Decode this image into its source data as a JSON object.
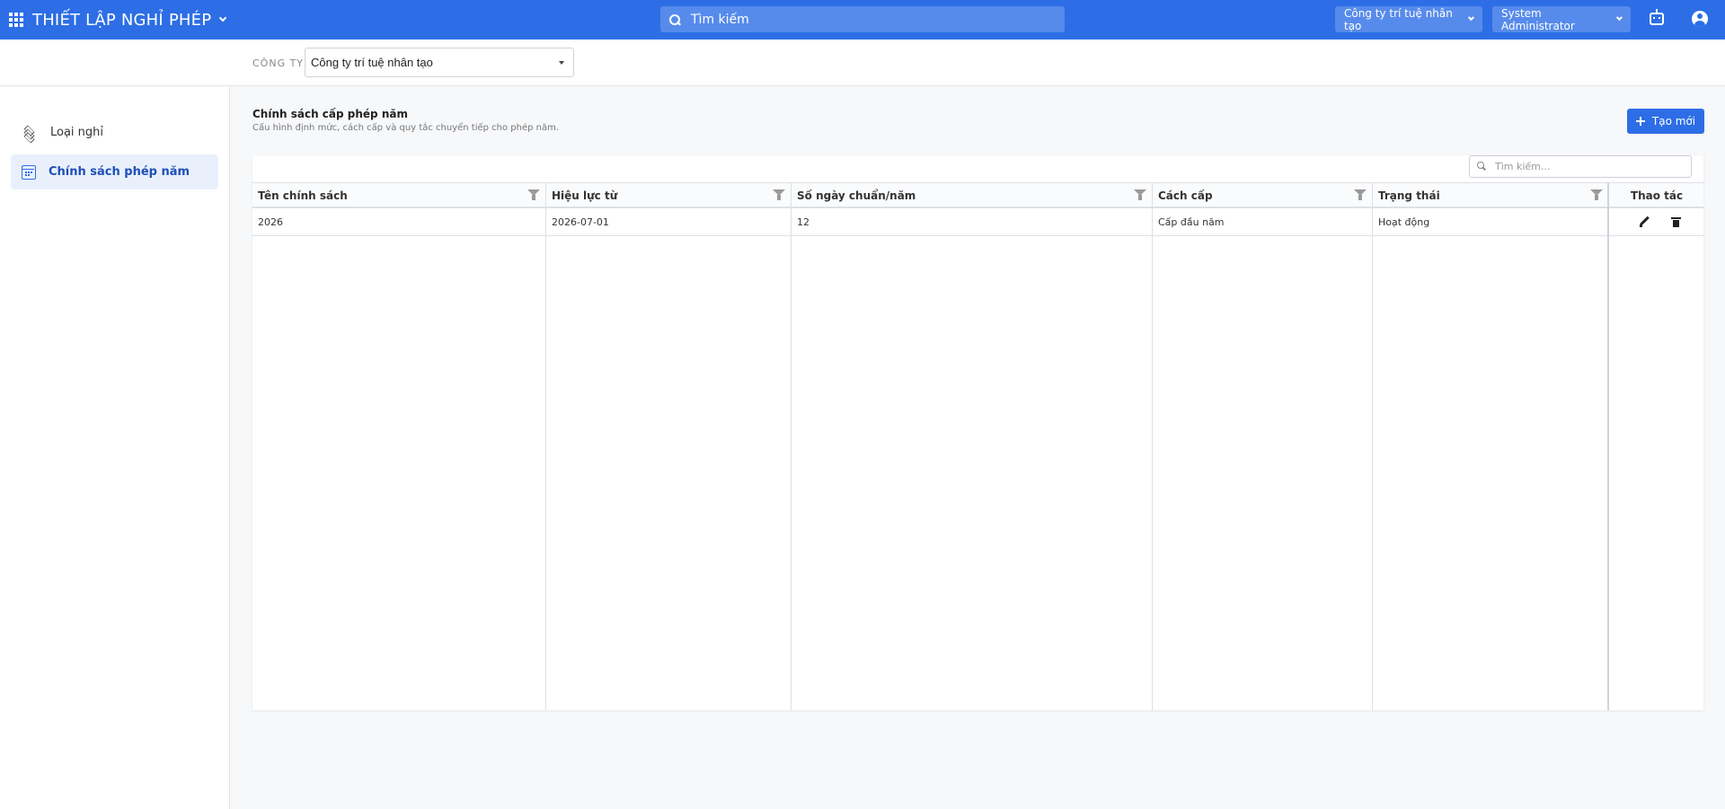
{
  "topbar": {
    "app_title": "THIẾT LẬP NGHỈ PHÉP",
    "search_placeholder": "Tìm kiếm",
    "company_switcher": "Công ty trí tuệ nhân tạo",
    "user_menu": "System Administrator",
    "accent_color": "#2d6ee6"
  },
  "company_bar": {
    "label": "CÔNG TY",
    "selected_company": "Công ty trí tuệ nhân tạo"
  },
  "sidebar": {
    "items": [
      {
        "label": "Loại nghỉ",
        "icon": "layers-icon",
        "active": false
      },
      {
        "label": "Chính sách phép năm",
        "icon": "calendar-icon",
        "active": true
      }
    ]
  },
  "main": {
    "title": "Chính sách cấp phép năm",
    "subtitle": "Cấu hình định mức, cách cấp và quy tắc chuyển tiếp cho phép năm.",
    "create_button": "Tạo mới",
    "grid_search_placeholder": "Tìm kiếm...",
    "columns": [
      "Tên chính sách",
      "Hiệu lực từ",
      "Số ngày chuẩn/năm",
      "Cách cấp",
      "Trạng thái",
      "Thao tác"
    ],
    "rows": [
      {
        "name": "2026",
        "effective_from": "2026-07-01",
        "days_per_year": "12",
        "grant_method": "Cấp đầu năm",
        "status": "Hoạt động"
      }
    ]
  }
}
